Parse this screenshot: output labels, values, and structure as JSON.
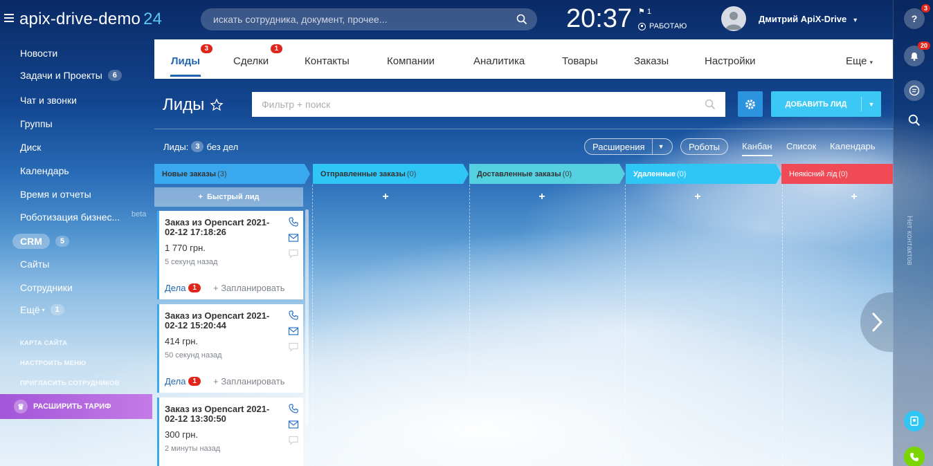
{
  "header": {
    "portal_name": "apix-drive-demo",
    "portal_num": "24",
    "search_placeholder": "искать сотрудника, документ, прочее...",
    "clock": "20:37",
    "flag_count": "1",
    "work_status": "РАБОТАЮ",
    "user_name": "Дмитрий ApiX-Drive"
  },
  "sidebar": {
    "items": [
      {
        "label": "Новости"
      },
      {
        "label": "Задачи и Проекты",
        "count": "6"
      },
      {
        "label": "Чат и звонки"
      },
      {
        "label": "Группы"
      },
      {
        "label": "Диск"
      },
      {
        "label": "Календарь"
      },
      {
        "label": "Время и отчеты"
      },
      {
        "label": "Роботизация бизнес...",
        "badge": "beta"
      },
      {
        "label": "CRM",
        "count": "5"
      },
      {
        "label": "Сайты"
      },
      {
        "label": "Сотрудники"
      },
      {
        "label": "Ещё",
        "count": "1"
      }
    ],
    "links": [
      "КАРТА САЙТА",
      "НАСТРОИТЬ МЕНЮ",
      "ПРИГЛАСИТЬ СОТРУДНИКОВ"
    ],
    "upgrade": "РАСШИРИТЬ ТАРИФ"
  },
  "tabs": [
    {
      "label": "Лиды",
      "badge": "3"
    },
    {
      "label": "Сделки",
      "badge": "1"
    },
    {
      "label": "Контакты"
    },
    {
      "label": "Компании"
    },
    {
      "label": "Аналитика"
    },
    {
      "label": "Товары"
    },
    {
      "label": "Заказы"
    },
    {
      "label": "Настройки"
    },
    {
      "label": "Еще"
    }
  ],
  "toolbar": {
    "title": "Лиды",
    "filter_placeholder": "Фильтр + поиск",
    "add_label": "ДОБАВИТЬ ЛИД"
  },
  "subbar": {
    "leads_label": "Лиды:",
    "leads_count": "3",
    "leads_suffix": "без дел",
    "extensions": "Расширения",
    "robots": "Роботы",
    "views": [
      "Канбан",
      "Список",
      "Календарь"
    ]
  },
  "stages": [
    {
      "name": "Новые заказы",
      "count": "(3)",
      "color": "#39a8ef"
    },
    {
      "name": "Отправленные заказы",
      "count": "(0)",
      "color": "#2fc6f6"
    },
    {
      "name": "Доставленные заказы",
      "count": "(0)",
      "color": "#55d0e0"
    },
    {
      "name": "Удаленные",
      "count": "(0)",
      "color": "#2fc6f6",
      "text_color": "#fff"
    },
    {
      "name": "Неякісний лід",
      "count": "(0)",
      "color": "#ef4a55",
      "text_color": "#fff"
    }
  ],
  "quick_lead": "Быстрый лид",
  "cards": [
    {
      "title": "Заказ из Opencart 2021-02-12 17:18:26",
      "price": "1 770 грн.",
      "ago": "5 секунд назад",
      "deals": "Дела",
      "deals_count": "1",
      "plan": "+ Запланировать"
    },
    {
      "title": "Заказ из Opencart 2021-02-12 15:20:44",
      "price": "414 грн.",
      "ago": "50 секунд назад",
      "deals": "Дела",
      "deals_count": "1",
      "plan": "+ Запланировать"
    },
    {
      "title": "Заказ из Opencart 2021-02-12 13:30:50",
      "price": "300 грн.",
      "ago": "2 минуты назад"
    }
  ],
  "rightbar": {
    "help_badge": "3",
    "notif_badge": "20",
    "no_contacts": "Нет контактов"
  }
}
